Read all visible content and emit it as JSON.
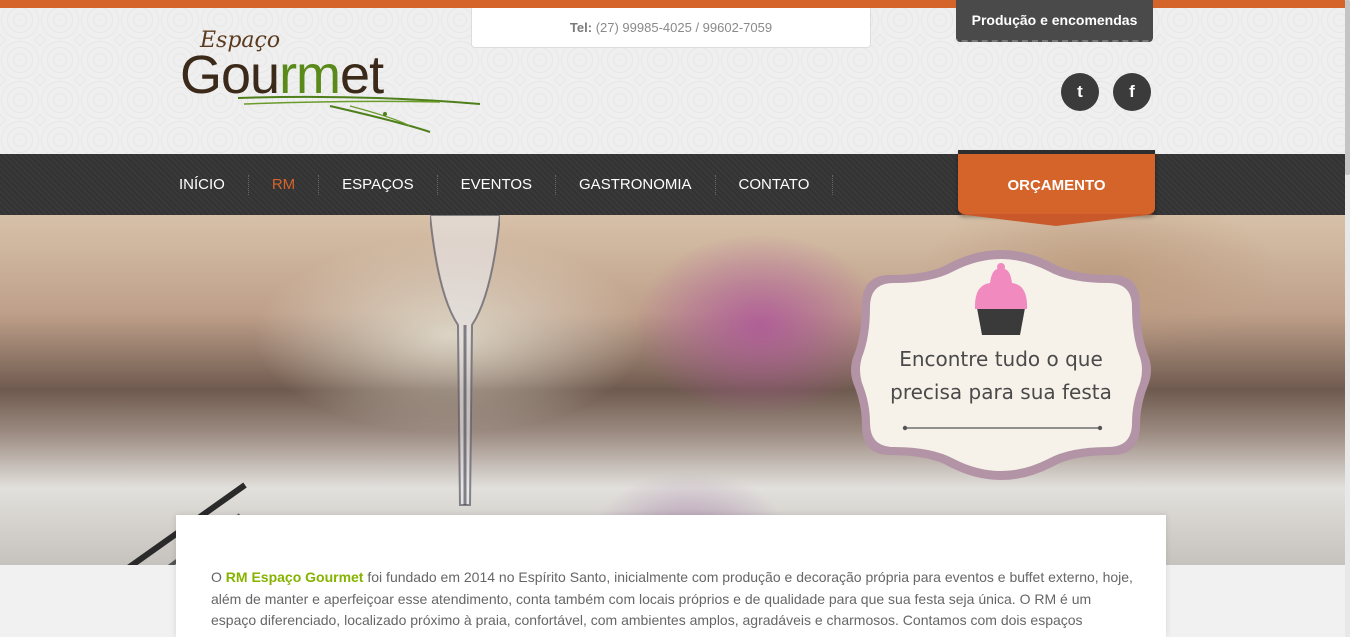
{
  "header": {
    "phone_label": "Tel:",
    "phone_numbers": "(27) 99985-4025 / 99602-7059",
    "producao_tab": "Produção e encomendas",
    "logo_top": "Espaço",
    "logo_main_a": "Gou",
    "logo_main_rm": "rm",
    "logo_main_b": "et",
    "social": [
      {
        "icon": "twitter-icon",
        "glyph": "t"
      },
      {
        "icon": "facebook-icon",
        "glyph": "f"
      }
    ]
  },
  "nav": {
    "items": [
      {
        "label": "INÍCIO"
      },
      {
        "label": "RM",
        "active": true
      },
      {
        "label": "ESPAÇOS"
      },
      {
        "label": "EVENTOS"
      },
      {
        "label": "GASTRONOMIA"
      },
      {
        "label": "CONTATO"
      }
    ],
    "cta": "ORÇAMENTO"
  },
  "hero": {
    "badge_line1": "Encontre tudo o que",
    "badge_line2": "precisa para sua festa",
    "badge_icon": "cupcake-icon"
  },
  "content": {
    "intro_prefix": "O",
    "brand": "RM Espaço Gourmet",
    "paragraph": "foi fundado em 2014 no Espírito Santo, inicialmente com produção e decoração própria para eventos e buffet externo, hoje, além de manter e aperfeiçoar esse atendimento, conta também com locais próprios e de qualidade para que sua festa seja única. O RM é um espaço diferenciado, localizado próximo à praia, confortável, com ambientes amplos, agradáveis e charmosos. Contamos com dois espaços"
  },
  "colors": {
    "accent": "#d5642b",
    "nav_bg": "#333333",
    "brand_green": "#86b300"
  }
}
